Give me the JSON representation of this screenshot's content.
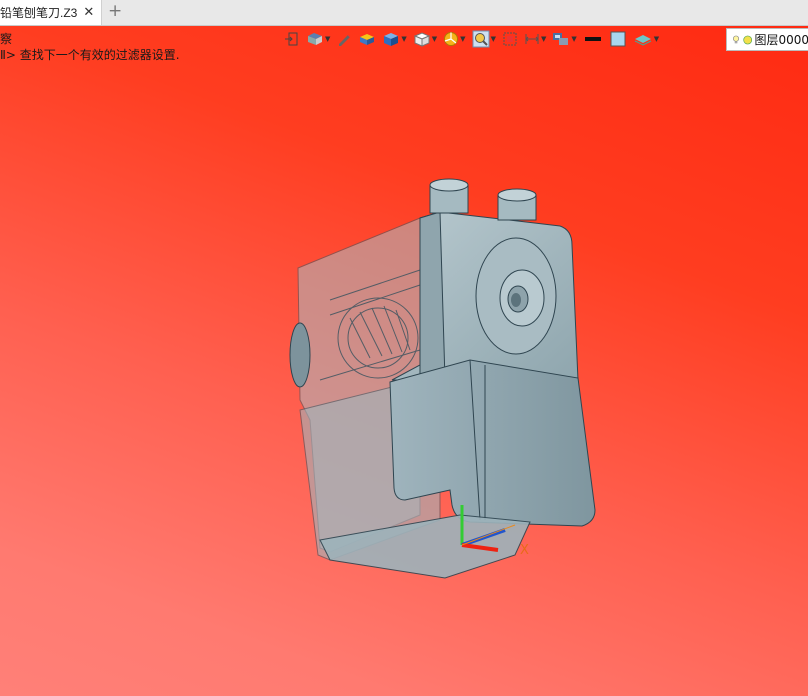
{
  "tab": {
    "title": "铅笔刨笔刀.Z3",
    "close": "✕",
    "add": "+"
  },
  "messages": {
    "line1": "察",
    "line2": "Ⅱ> 查找下一个有效的过滤器设置."
  },
  "toolbar": {
    "layer_label": "图层0000",
    "icons": [
      "exit-icon",
      "view-icon",
      "pencil-icon",
      "box-icon",
      "cube-icon",
      "white-cube-icon",
      "pie-icon",
      "zoom-icon",
      "fit-icon",
      "align-icon",
      "display-icon",
      "color-swatch-icon",
      "fill-icon",
      "layer-icon",
      "bulb-icon",
      "status-icon"
    ]
  },
  "axes": {
    "x": "X"
  },
  "colors": {
    "background_top": "#ff2a12",
    "background_bottom": "#ff8078",
    "model": "#9db3bb"
  }
}
